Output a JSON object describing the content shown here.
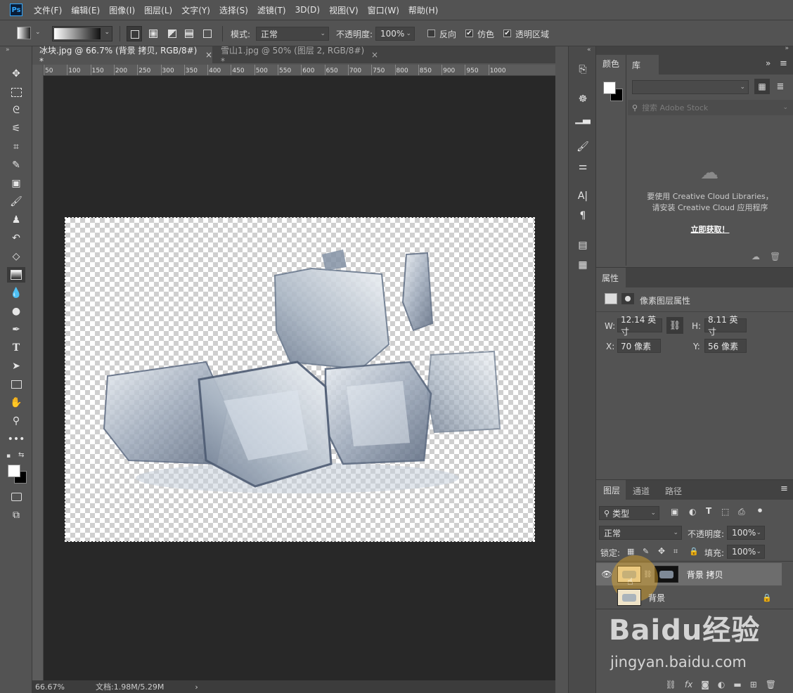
{
  "app": {
    "logo": "Ps"
  },
  "menu": [
    "文件(F)",
    "编辑(E)",
    "图像(I)",
    "图层(L)",
    "文字(Y)",
    "选择(S)",
    "滤镜(T)",
    "3D(D)",
    "视图(V)",
    "窗口(W)",
    "帮助(H)"
  ],
  "options": {
    "mode_label": "模式:",
    "mode_value": "正常",
    "opacity_label": "不透明度:",
    "opacity_value": "100%",
    "reverse_label": "反向",
    "dither_label": "仿色",
    "transparency_label": "透明区域",
    "check_mark": "✔"
  },
  "tabs": [
    {
      "label": "冰块.jpg @ 66.7% (背景 拷贝, RGB/8#) *",
      "close": "×"
    },
    {
      "label": "雪山1.jpg @ 50% (图层 2, RGB/8#) *",
      "close": "×"
    }
  ],
  "ruler_ticks": [
    "50",
    "100",
    "150",
    "200",
    "250",
    "300",
    "350",
    "400",
    "450",
    "500",
    "550",
    "600",
    "650",
    "700",
    "750",
    "800",
    "850",
    "900",
    "950",
    "1000"
  ],
  "status": {
    "zoom": "66.67%",
    "doc": "文档:1.98M/5.29M",
    "arrow": "›"
  },
  "color_panel": {
    "title": "颜色"
  },
  "library_panel": {
    "title": "库",
    "search_placeholder": "搜索 Adobe Stock",
    "message_line1": "要使用 Creative Cloud Libraries，",
    "message_line2": "请安装 Creative Cloud 应用程序",
    "install_link": "立即获取！"
  },
  "properties": {
    "title": "属性",
    "subtitle": "像素图层属性",
    "w_label": "W:",
    "w_value": "12.14 英寸",
    "h_label": "H:",
    "h_value": "8.11 英寸",
    "x_label": "X:",
    "x_value": "70 像素",
    "y_label": "Y:",
    "y_value": "56 像素"
  },
  "layers_panel": {
    "tabs": [
      "图层",
      "通道",
      "路径"
    ],
    "filter_value": "类型",
    "blend_value": "正常",
    "opacity_label": "不透明度:",
    "opacity_value": "100%",
    "lock_label": "锁定:",
    "fill_label": "填充:",
    "fill_value": "100%",
    "layers": [
      {
        "name": "背景 拷贝",
        "visible": true,
        "selected": true
      },
      {
        "name": "背景",
        "visible": false,
        "locked": true
      }
    ]
  },
  "watermark": {
    "brand": "Baidu经验",
    "url": "jingyan.baidu.com"
  }
}
